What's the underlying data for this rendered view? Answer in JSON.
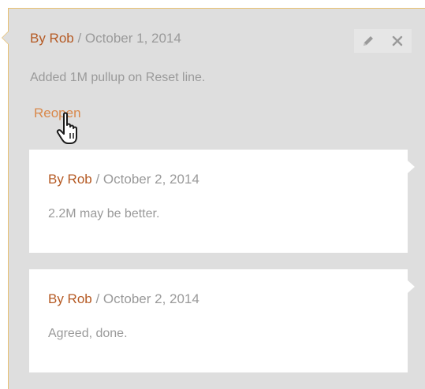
{
  "main_comment": {
    "author": "By Rob",
    "date_separator": " / ",
    "date": "October 1, 2014",
    "text": "Added 1M pullup on Reset line.",
    "reopen_label": "Reopen",
    "edit_icon": "pencil-icon",
    "delete_icon": "close-icon"
  },
  "replies": [
    {
      "author": "By Rob",
      "date_separator": " / ",
      "date": "October 2, 2014",
      "text": "2.2M may be better."
    },
    {
      "author": "By Rob",
      "date_separator": " / ",
      "date": "October 2, 2014",
      "text": "Agreed, done."
    }
  ],
  "colors": {
    "author": "#b55a24",
    "reopen": "#d9884a",
    "muted_text": "#9a9a9a",
    "panel_bg": "#dedede",
    "panel_accent": "#e8c070",
    "card_bg": "#ffffff"
  }
}
